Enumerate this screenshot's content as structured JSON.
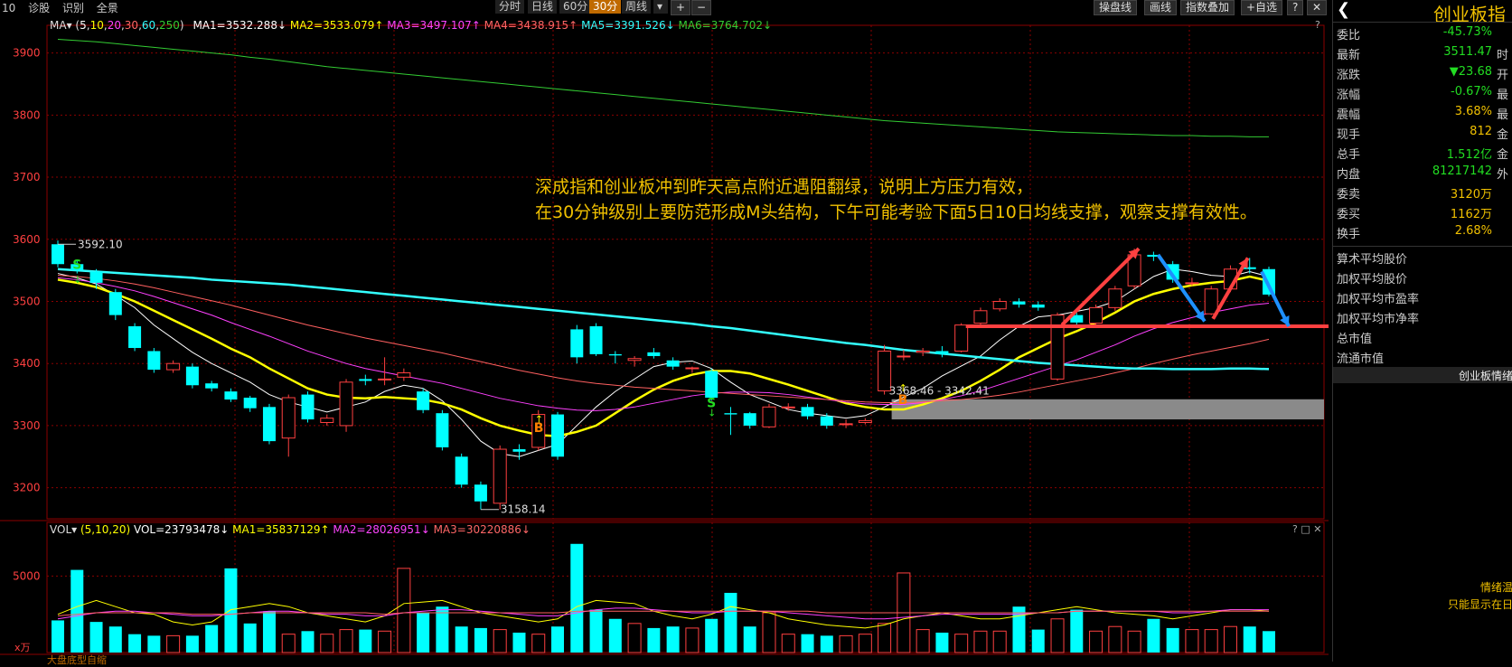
{
  "toolbar": {
    "left_items": [
      "10",
      "诊股",
      "识别",
      "全景"
    ],
    "timeframes": [
      "分时",
      "日线",
      "60分",
      "30分",
      "周线"
    ],
    "active_timeframe": "30分",
    "plus": "+",
    "minus": "−",
    "right_buttons": [
      "操盘线",
      "画线",
      "指数叠加",
      "+自选"
    ],
    "help": "?",
    "close": "✕"
  },
  "price_indicator": {
    "label": "MA▾",
    "params_open": "(",
    "params": [
      "5",
      "10",
      "20",
      "30",
      "60",
      "250"
    ],
    "params_close": ")",
    "ma1": "MA1=3532.288↓",
    "ma2": "MA2=3533.079↑",
    "ma3": "MA3=3497.107↑",
    "ma4": "MA4=3438.915↑",
    "ma5": "MA5=3391.526↓",
    "ma6": "MA6=3764.702↓",
    "help": "?"
  },
  "volume_indicator": {
    "label": "VOL▾",
    "params": "(5,10,20)",
    "vol": "VOL=23793478↓",
    "ma1": "MA1=35837129↑",
    "ma2": "MA2=28026951↓",
    "ma3": "MA3=30220886↓",
    "controls": "? □ ✕"
  },
  "annotation": {
    "line1": "深成指和创业板冲到昨天高点附近遇阻翻绿，说明上方压力有效，",
    "line2": "在30分钟级别上要防范形成M头结构，下午可能考验下面5日10日均线支撑，观察支撑有效性。"
  },
  "y_axis_labels": [
    "3900",
    "3800",
    "3700",
    "3600",
    "3500",
    "3400",
    "3300",
    "3200"
  ],
  "vol_axis_labels": [
    "5000"
  ],
  "vol_unit": "x万",
  "price_marks": {
    "high": "3592.10",
    "low": "3158.14",
    "zone": "3368.46 - 3342.41"
  },
  "signals": {
    "s": "S",
    "b": "B"
  },
  "bottom_hint": "大盘底型自缩",
  "right_panel": {
    "title": "创业板指",
    "back": "❮",
    "rows": [
      {
        "k": "委比",
        "v": "-45.73%",
        "t": "",
        "color": "#22dd22"
      },
      {
        "k": "最新",
        "v": "3511.47",
        "t": "时",
        "color": "#22dd22"
      },
      {
        "k": "涨跌",
        "v": "▼23.68",
        "t": "开",
        "color": "#22dd22"
      },
      {
        "k": "涨幅",
        "v": "-0.67%",
        "t": "最",
        "color": "#22dd22"
      },
      {
        "k": "震幅",
        "v": "3.68%",
        "t": "最",
        "color": "#f0c000"
      },
      {
        "k": "现手",
        "v": "812",
        "t": "金",
        "color": "#f0c000"
      },
      {
        "k": "总手",
        "v": "1.512亿",
        "t": "金",
        "color": "#22dd22"
      },
      {
        "k": "内盘",
        "v": "81217142",
        "t": "外",
        "color": "#22dd22"
      },
      {
        "k": "委卖",
        "v": "3120万",
        "t": "",
        "color": "#f0c000"
      },
      {
        "k": "委买",
        "v": "1162万",
        "t": "",
        "color": "#f0c000"
      },
      {
        "k": "换手",
        "v": "2.68%",
        "t": "",
        "color": "#f0c000"
      }
    ],
    "list": [
      "算术平均股价",
      "加权平均股价",
      "加权平均市盈率",
      "加权平均市净率",
      "总市值",
      "流通市值"
    ],
    "section": "创业板情绪",
    "mood1": "情绪温",
    "mood2": "只能显示在日"
  },
  "chart_data": {
    "type": "candlestick",
    "timeframe": "30分",
    "ylim": [
      3150,
      3930
    ],
    "candles": [
      [
        3592,
        3560,
        3598,
        3555
      ],
      [
        3560,
        3550,
        3565,
        3545
      ],
      [
        3548,
        3530,
        3552,
        3520
      ],
      [
        3515,
        3478,
        3520,
        3470
      ],
      [
        3460,
        3425,
        3465,
        3420
      ],
      [
        3420,
        3390,
        3425,
        3385
      ],
      [
        3390,
        3400,
        3405,
        3385
      ],
      [
        3395,
        3365,
        3400,
        3360
      ],
      [
        3368,
        3360,
        3372,
        3355
      ],
      [
        3355,
        3342,
        3360,
        3338
      ],
      [
        3345,
        3328,
        3348,
        3322
      ],
      [
        3330,
        3275,
        3335,
        3270
      ],
      [
        3280,
        3345,
        3350,
        3250
      ],
      [
        3350,
        3310,
        3355,
        3305
      ],
      [
        3305,
        3312,
        3318,
        3300
      ],
      [
        3300,
        3370,
        3375,
        3290
      ],
      [
        3375,
        3372,
        3382,
        3365
      ],
      [
        3375,
        3375,
        3410,
        3365
      ],
      [
        3378,
        3385,
        3392,
        3372
      ],
      [
        3355,
        3325,
        3360,
        3320
      ],
      [
        3320,
        3265,
        3325,
        3260
      ],
      [
        3250,
        3205,
        3255,
        3200
      ],
      [
        3205,
        3178,
        3210,
        3165
      ],
      [
        3175,
        3262,
        3268,
        3165
      ],
      [
        3262,
        3258,
        3270,
        3245
      ],
      [
        3265,
        3318,
        3325,
        3260
      ],
      [
        3318,
        3250,
        3322,
        3245
      ],
      [
        3455,
        3410,
        3462,
        3400
      ],
      [
        3460,
        3415,
        3465,
        3412
      ],
      [
        3415,
        3413,
        3420,
        3400
      ],
      [
        3405,
        3408,
        3412,
        3395
      ],
      [
        3418,
        3412,
        3425,
        3408
      ],
      [
        3405,
        3395,
        3410,
        3390
      ],
      [
        3392,
        3393,
        3395,
        3385
      ],
      [
        3388,
        3345,
        3392,
        3340
      ],
      [
        3320,
        3318,
        3330,
        3285
      ],
      [
        3320,
        3300,
        3322,
        3295
      ],
      [
        3298,
        3330,
        3335,
        3296
      ],
      [
        3330,
        3330,
        3336,
        3324
      ],
      [
        3330,
        3315,
        3335,
        3310
      ],
      [
        3315,
        3300,
        3320,
        3295
      ],
      [
        3302,
        3303,
        3310,
        3296
      ],
      [
        3305,
        3308,
        3312,
        3302
      ],
      [
        3356,
        3420,
        3430,
        3350
      ],
      [
        3412,
        3412,
        3422,
        3405
      ],
      [
        3418,
        3420,
        3425,
        3412
      ],
      [
        3420,
        3415,
        3428,
        3410
      ],
      [
        3420,
        3462,
        3465,
        3418
      ],
      [
        3465,
        3485,
        3490,
        3460
      ],
      [
        3488,
        3500,
        3505,
        3484
      ],
      [
        3500,
        3495,
        3505,
        3490
      ],
      [
        3495,
        3490,
        3500,
        3485
      ],
      [
        3375,
        3478,
        3482,
        3372
      ],
      [
        3478,
        3466,
        3482,
        3460
      ],
      [
        3465,
        3490,
        3495,
        3460
      ],
      [
        3490,
        3520,
        3525,
        3485
      ],
      [
        3525,
        3575,
        3585,
        3520
      ],
      [
        3575,
        3572,
        3580,
        3565
      ],
      [
        3560,
        3535,
        3565,
        3530
      ],
      [
        3530,
        3530,
        3538,
        3525
      ],
      [
        3480,
        3520,
        3525,
        3478
      ],
      [
        3520,
        3552,
        3558,
        3515
      ],
      [
        3555,
        3552,
        3570,
        3545
      ],
      [
        3552,
        3511,
        3556,
        3508
      ]
    ],
    "ma_lines": {
      "MA1": [
        3545,
        3538,
        3528,
        3510,
        3490,
        3462,
        3440,
        3418,
        3400,
        3385,
        3370,
        3350,
        3338,
        3330,
        3322,
        3330,
        3338,
        3355,
        3365,
        3360,
        3340,
        3310,
        3275,
        3255,
        3250,
        3260,
        3270,
        3300,
        3330,
        3355,
        3375,
        3395,
        3402,
        3404,
        3392,
        3370,
        3350,
        3338,
        3326,
        3320,
        3316,
        3312,
        3316,
        3330,
        3346,
        3360,
        3380,
        3396,
        3412,
        3438,
        3460,
        3475,
        3478,
        3484,
        3490,
        3500,
        3520,
        3540,
        3552,
        3548,
        3542,
        3540,
        3548,
        3540
      ],
      "MA2": [
        3535,
        3530,
        3523,
        3512,
        3500,
        3485,
        3470,
        3455,
        3440,
        3424,
        3410,
        3392,
        3376,
        3360,
        3350,
        3345,
        3344,
        3346,
        3344,
        3342,
        3336,
        3326,
        3312,
        3300,
        3292,
        3285,
        3283,
        3290,
        3300,
        3320,
        3340,
        3358,
        3372,
        3382,
        3388,
        3388,
        3384,
        3375,
        3366,
        3356,
        3346,
        3336,
        3330,
        3326,
        3326,
        3334,
        3344,
        3356,
        3372,
        3390,
        3410,
        3425,
        3440,
        3452,
        3466,
        3482,
        3500,
        3512,
        3520,
        3526,
        3530,
        3533,
        3540,
        3533
      ],
      "MA3": [
        3538,
        3535,
        3530,
        3524,
        3517,
        3508,
        3498,
        3488,
        3478,
        3466,
        3455,
        3444,
        3432,
        3420,
        3410,
        3400,
        3392,
        3386,
        3380,
        3374,
        3368,
        3360,
        3352,
        3344,
        3338,
        3332,
        3328,
        3325,
        3324,
        3326,
        3330,
        3336,
        3342,
        3348,
        3352,
        3354,
        3354,
        3353,
        3350,
        3346,
        3342,
        3338,
        3335,
        3334,
        3334,
        3337,
        3342,
        3348,
        3356,
        3366,
        3376,
        3386,
        3396,
        3406,
        3418,
        3430,
        3444,
        3456,
        3466,
        3474,
        3482,
        3488,
        3494,
        3497
      ],
      "MA4": [
        3542,
        3540,
        3537,
        3533,
        3528,
        3522,
        3515,
        3508,
        3501,
        3494,
        3486,
        3478,
        3470,
        3462,
        3455,
        3448,
        3441,
        3435,
        3429,
        3423,
        3417,
        3410,
        3403,
        3396,
        3389,
        3383,
        3377,
        3372,
        3368,
        3365,
        3362,
        3360,
        3358,
        3356,
        3354,
        3352,
        3350,
        3348,
        3346,
        3344,
        3342,
        3340,
        3338,
        3337,
        3337,
        3338,
        3340,
        3342,
        3345,
        3349,
        3354,
        3360,
        3366,
        3372,
        3378,
        3385,
        3392,
        3400,
        3407,
        3414,
        3420,
        3426,
        3432,
        3439
      ],
      "MA5": [
        3552,
        3550,
        3548,
        3546,
        3544,
        3542,
        3540,
        3538,
        3535,
        3533,
        3531,
        3529,
        3527,
        3524,
        3521,
        3518,
        3515,
        3512,
        3509,
        3506,
        3503,
        3500,
        3497,
        3494,
        3491,
        3488,
        3485,
        3482,
        3479,
        3476,
        3473,
        3470,
        3467,
        3464,
        3460,
        3457,
        3453,
        3449,
        3445,
        3441,
        3437,
        3433,
        3430,
        3426,
        3422,
        3419,
        3416,
        3413,
        3410,
        3407,
        3404,
        3401,
        3399,
        3397,
        3395,
        3393,
        3392,
        3392,
        3391,
        3391,
        3391,
        3392,
        3392,
        3391
      ],
      "MA6": [
        3922,
        3920,
        3918,
        3915,
        3912,
        3909,
        3906,
        3903,
        3900,
        3897,
        3893,
        3890,
        3886,
        3882,
        3878,
        3875,
        3872,
        3869,
        3866,
        3863,
        3860,
        3857,
        3854,
        3851,
        3848,
        3845,
        3842,
        3839,
        3836,
        3833,
        3830,
        3827,
        3824,
        3821,
        3818,
        3815,
        3812,
        3809,
        3806,
        3803,
        3800,
        3797,
        3794,
        3791,
        3789,
        3787,
        3785,
        3783,
        3781,
        3779,
        3777,
        3775,
        3773,
        3772,
        3771,
        3770,
        3769,
        3768,
        3767,
        3767,
        3766,
        3766,
        3765,
        3765
      ]
    },
    "volume": [
      21,
      54,
      20,
      17,
      12,
      11,
      11,
      11,
      18,
      55,
      19,
      27,
      12,
      14,
      12,
      15,
      15,
      14,
      55,
      26,
      30,
      17,
      16,
      15,
      13,
      12,
      17,
      71,
      28,
      22,
      19,
      16,
      17,
      16,
      22,
      39,
      17,
      26,
      12,
      12,
      11,
      11,
      12,
      19,
      52,
      15,
      13,
      12,
      14,
      14,
      30,
      15,
      22,
      28,
      14,
      17,
      14,
      22,
      16,
      15,
      15,
      17,
      17,
      14
    ],
    "volume_ma": {
      "MA1": [
        25,
        30,
        34,
        30,
        26,
        25,
        20,
        18,
        20,
        28,
        30,
        32,
        30,
        26,
        24,
        22,
        20,
        24,
        32,
        33,
        34,
        30,
        26,
        24,
        22,
        20,
        22,
        30,
        34,
        33,
        32,
        27,
        24,
        22,
        25,
        30,
        28,
        26,
        22,
        20,
        18,
        17,
        16,
        18,
        22,
        24,
        26,
        24,
        22,
        22,
        24,
        26,
        28,
        30,
        28,
        26,
        25,
        24,
        22,
        24,
        26,
        28,
        28,
        27
      ],
      "MA2": [
        22,
        24,
        26,
        27,
        27,
        26,
        25,
        24,
        24,
        25,
        26,
        27,
        27,
        26,
        25,
        25,
        24,
        24,
        26,
        27,
        28,
        28,
        27,
        26,
        25,
        24,
        24,
        26,
        28,
        29,
        29,
        28,
        27,
        26,
        26,
        27,
        27,
        27,
        26,
        25,
        24,
        23,
        22,
        22,
        23,
        24,
        25,
        25,
        25,
        25,
        25,
        26,
        26,
        27,
        27,
        27,
        27,
        27,
        26,
        26,
        27,
        28,
        28,
        28
      ],
      "MA3": [
        24,
        25,
        26,
        26,
        26,
        26,
        26,
        25,
        25,
        25,
        26,
        26,
        26,
        26,
        26,
        26,
        26,
        25,
        26,
        26,
        26,
        26,
        26,
        26,
        26,
        26,
        26,
        27,
        27,
        27,
        27,
        27,
        27,
        27,
        27,
        27,
        27,
        27,
        27,
        27,
        26,
        26,
        26,
        26,
        26,
        26,
        26,
        26,
        26,
        26,
        26,
        26,
        26,
        27,
        27,
        27,
        27,
        27,
        27,
        27,
        27,
        27,
        27,
        27
      ]
    }
  },
  "colors": {
    "up": "#ff4040",
    "down": "#00ffff",
    "ma1": "#ffffff",
    "ma2": "#ffff00",
    "ma3": "#ff40ff",
    "ma4": "#ff6060",
    "ma5": "#33ffff",
    "ma6": "#33cc33",
    "grid": "#8b0000",
    "arrow_red": "#ff4040",
    "arrow_blue": "#1e90ff",
    "support_line": "#ff4040"
  }
}
